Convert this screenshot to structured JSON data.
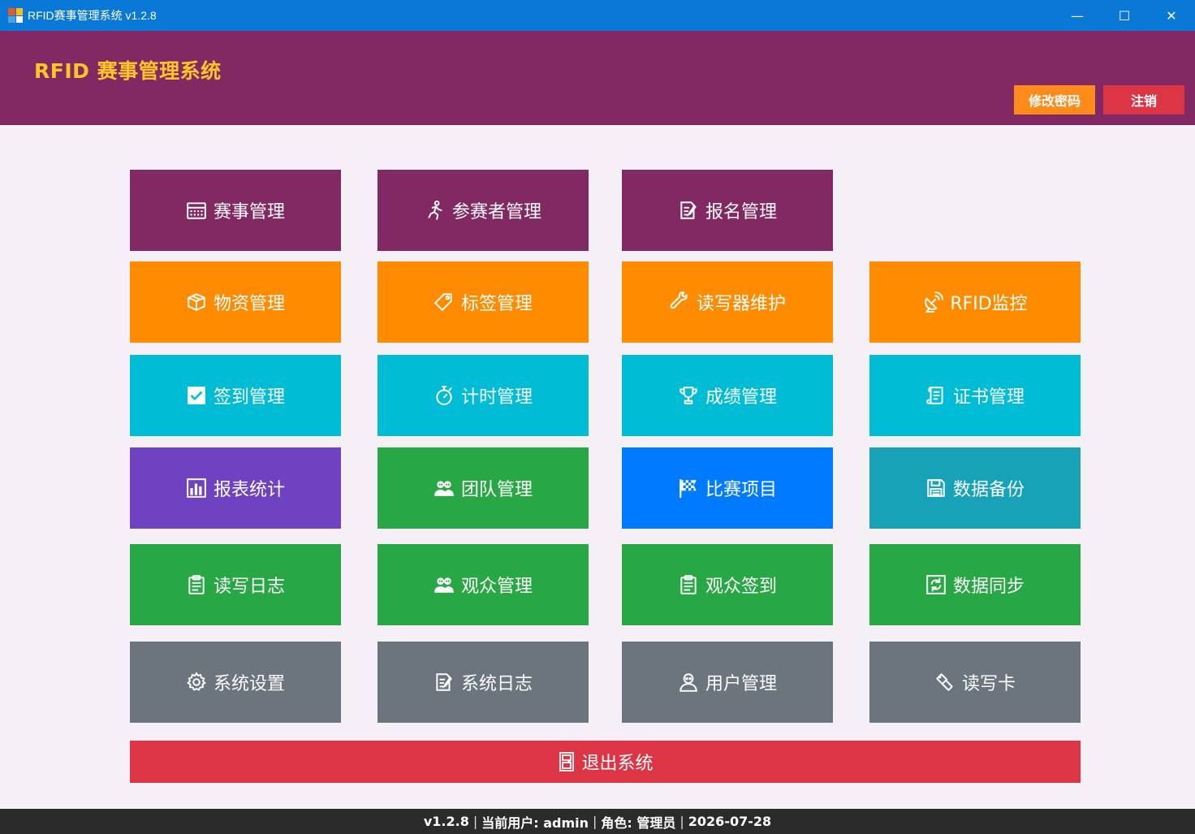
{
  "window": {
    "title": "RFID赛事管理系统 v1.2.8",
    "controls": {
      "minimize": "—",
      "maximize": "☐",
      "close": "✕"
    }
  },
  "header": {
    "brand": "RFID 赛事管理系统",
    "change_password": "修改密码",
    "logout": "注销",
    "colors": {
      "background": "#822862",
      "brand": "#ffc42a",
      "password_btn": "#ff8c1a",
      "logout_btn": "#dc3545"
    }
  },
  "tiles": {
    "event_mgmt": {
      "label": "赛事管理",
      "icon": "calendar-icon"
    },
    "participant_mgmt": {
      "label": "参赛者管理",
      "icon": "runner-icon"
    },
    "registration_mgmt": {
      "label": "报名管理",
      "icon": "edit-document-icon"
    },
    "material_mgmt": {
      "label": "物资管理",
      "icon": "box-icon"
    },
    "tag_mgmt": {
      "label": "标签管理",
      "icon": "tag-icon"
    },
    "reader_maintenance": {
      "label": "读写器维护",
      "icon": "wrench-icon"
    },
    "rfid_monitor": {
      "label": "RFID监控",
      "icon": "antenna-icon"
    },
    "checkin_mgmt": {
      "label": "签到管理",
      "icon": "checkbox-icon"
    },
    "timing_mgmt": {
      "label": "计时管理",
      "icon": "stopwatch-icon"
    },
    "score_mgmt": {
      "label": "成绩管理",
      "icon": "trophy-icon"
    },
    "certificate_mgmt": {
      "label": "证书管理",
      "icon": "scroll-icon"
    },
    "report_stats": {
      "label": "报表统计",
      "icon": "bar-chart-icon"
    },
    "team_mgmt": {
      "label": "团队管理",
      "icon": "group-icon"
    },
    "race_items": {
      "label": "比赛项目",
      "icon": "checkered-flag-icon"
    },
    "data_backup": {
      "label": "数据备份",
      "icon": "save-icon"
    },
    "rw_log": {
      "label": "读写日志",
      "icon": "clipboard-icon"
    },
    "audience_mgmt": {
      "label": "观众管理",
      "icon": "group-icon"
    },
    "audience_checkin": {
      "label": "观众签到",
      "icon": "clipboard-icon"
    },
    "data_sync": {
      "label": "数据同步",
      "icon": "sync-icon"
    },
    "system_settings": {
      "label": "系统设置",
      "icon": "gear-icon"
    },
    "system_log": {
      "label": "系统日志",
      "icon": "edit-document-icon"
    },
    "user_mgmt": {
      "label": "用户管理",
      "icon": "user-icon"
    },
    "rw_card": {
      "label": "读写卡",
      "icon": "card-writer-icon"
    }
  },
  "exit": {
    "label": "退出系统",
    "icon": "door-icon"
  },
  "status": {
    "version": "v1.2.8",
    "current_user": "当前用户: admin",
    "role": "角色: 管理员",
    "date": "2026-07-28"
  },
  "colors": {
    "purple": "#822862",
    "orange": "#ff8c00",
    "cyan": "#00bcd4",
    "violet": "#6f42c1",
    "green": "#28a745",
    "blue": "#007bff",
    "teal": "#17a2b8",
    "gray": "#6c757d",
    "red": "#dc3545"
  }
}
